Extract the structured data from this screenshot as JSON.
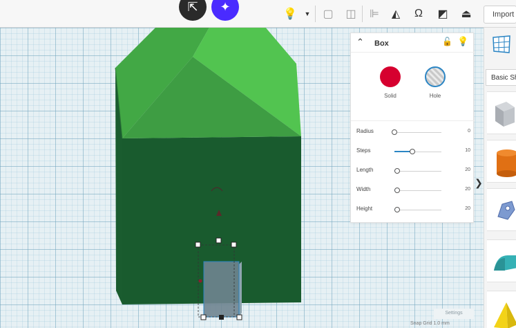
{
  "toolbar": {
    "import_label": "Import",
    "icons": [
      "share-icon",
      "ai-sparkle-icon",
      "lightbulb-icon",
      "dropdown-icon",
      "group-icon",
      "ungroup-icon",
      "align-icon",
      "mirror-icon",
      "cruise-icon",
      "workplane-icon",
      "ruler-icon"
    ]
  },
  "inspector": {
    "title": "Box",
    "materials": {
      "solid_label": "Solid",
      "hole_label": "Hole",
      "solid_color": "#d6002f",
      "hole_border": "#2b85c4",
      "selected": "Hole"
    },
    "properties": [
      {
        "label": "Radius",
        "value": "0",
        "fraction": 0.0
      },
      {
        "label": "Steps",
        "value": "10",
        "fraction": 0.38
      },
      {
        "label": "Length",
        "value": "20",
        "fraction": 0.06
      },
      {
        "label": "Width",
        "value": "20",
        "fraction": 0.06
      },
      {
        "label": "Height",
        "value": "20",
        "fraction": 0.06
      }
    ]
  },
  "shapes_panel": {
    "category_label": "Basic Shapes",
    "items": [
      {
        "name": "box-shape-icon",
        "color": "#b8bcc2"
      },
      {
        "name": "cylinder-shape-icon",
        "color": "#e07014"
      },
      {
        "name": "scribble-shape-icon",
        "color": "#7d9ad0"
      },
      {
        "name": "roof-shape-icon",
        "color": "#35b1b5"
      },
      {
        "name": "pyramid-shape-icon",
        "color": "#f3d318"
      }
    ]
  },
  "scene": {
    "house_body_color": "#195b2e",
    "roof_color_light": "#4fc24f",
    "roof_color_dark": "#3fa143",
    "hole_box_color": "#6f8490",
    "accent": "#2b85c4"
  },
  "footer": {
    "settings_label": "Settings",
    "grid_text": "Snap Grid  1.0 mm"
  }
}
